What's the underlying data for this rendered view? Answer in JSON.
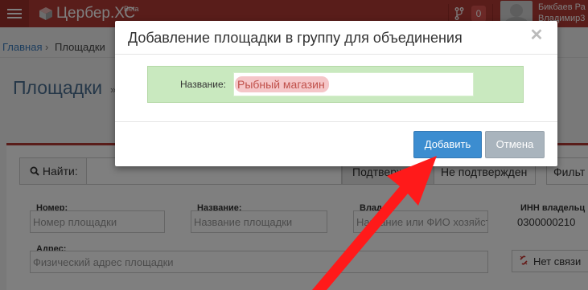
{
  "app": {
    "brand": "Цербер.ХС",
    "beta": "Beta",
    "notifications_count": "0",
    "user_name": "Бикбаев Ра",
    "user_sub": "Владимир3"
  },
  "breadcrumb": {
    "home": "Главная",
    "separator": "›",
    "current": "Площадки"
  },
  "page": {
    "title": "Площадки",
    "title_suffix": "»"
  },
  "toolbar": {
    "search_label": "Найти:",
    "confirmed": "Подтвержден",
    "unconfirmed": "Не подтвержден",
    "filter": "Фильт"
  },
  "filters": {
    "number_label": "Номер:",
    "number_placeholder": "Номер площадки",
    "name_label": "Название:",
    "name_placeholder": "Название площадки",
    "owner_label": "Влад...:",
    "owner_placeholder": "Название или ФИО хозяйст",
    "inn_label": "ИНН владельц",
    "inn_value": "0300000210",
    "address_label": "Адрес:",
    "address_placeholder": "Физический адрес площадки",
    "no_link_button": "Нет связи"
  },
  "modal": {
    "title": "Добавление площадки в группу для объединения",
    "close_symbol": "✕",
    "name_label": "Название:",
    "name_value": "Рыбный магазин",
    "add_button": "Добавить",
    "cancel_button": "Отмена"
  },
  "colors": {
    "navbar": "#b23b35",
    "primary_button": "#3c8dd0",
    "cancel_button": "#a9b4bd",
    "form_background": "#c9e9bf",
    "arrow": "#ff1a1a"
  }
}
